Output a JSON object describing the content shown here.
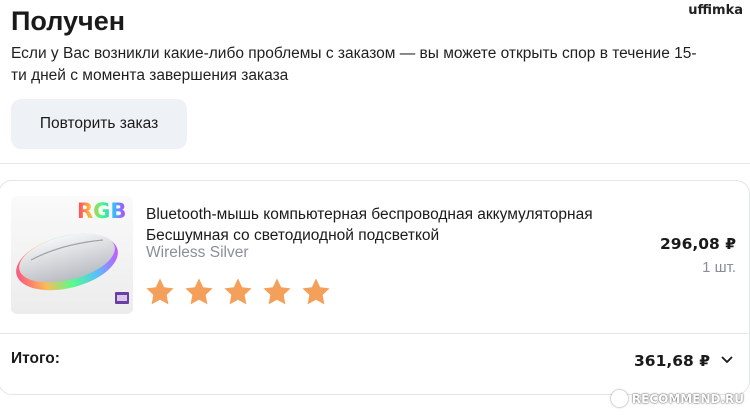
{
  "header": {
    "username": "uffimka",
    "status_title": "Получен",
    "status_description": "Если у Вас возникли какие-либо проблемы с заказом — вы можете открыть спор в течение 15-ти дней с момента завершения заказа"
  },
  "actions": {
    "repeat_order_label": "Повторить заказ"
  },
  "order": {
    "items": [
      {
        "image_label": "RGB",
        "name": "Bluetooth-мышь компьютерная беспроводная аккумуляторная Бесшумная со светодиодной подсветкой",
        "variant": "Wireless Silver",
        "rating": 5,
        "rating_max": 5,
        "price": "296,08 ₽",
        "quantity": "1 шт."
      }
    ],
    "total_label": "Итого:",
    "total_value": "361,68 ₽"
  },
  "colors": {
    "star": "#f5a05a",
    "button_bg": "#eef1f6"
  },
  "icons": {
    "expand": "chevron-down-icon",
    "rating": "star-icon"
  },
  "watermark": {
    "text": "RECOMMEND.RU"
  }
}
